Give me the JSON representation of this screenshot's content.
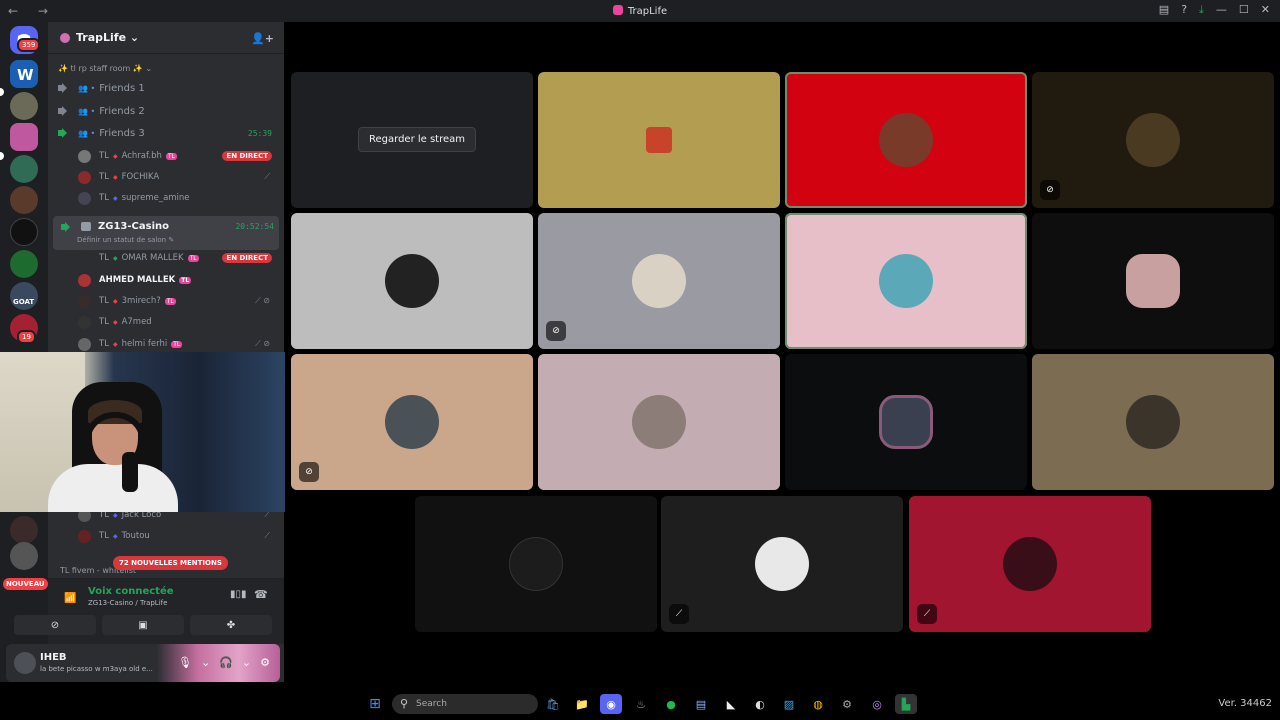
{
  "window": {
    "title": "TrapLife",
    "nav": "← →"
  },
  "guilds": {
    "dm_badge": "359",
    "server_badge": "19",
    "nouveau": "NOUVEAU"
  },
  "server": {
    "name": "TrapLife ⌄"
  },
  "category": "✨ tl rp staff room ✨ ⌄",
  "voice_channels": [
    {
      "name": "Friends 1",
      "timer": ""
    },
    {
      "name": "Friends 2",
      "timer": ""
    },
    {
      "name": "Friends 3",
      "timer": "25:39"
    }
  ],
  "friends3_users": [
    {
      "prefix": "TL",
      "name": "Achraf.bh",
      "tag": "TL",
      "live": "EN DIRECT"
    },
    {
      "prefix": "TL",
      "name": "FOCHIKA",
      "tag": "",
      "live": ""
    },
    {
      "prefix": "TL",
      "name": "supreme_amine",
      "tag": "",
      "live": ""
    }
  ],
  "casino": {
    "name": "ZG13-Casino",
    "status": "Définir un statut de salon ✎",
    "timer": "20:52:54"
  },
  "casino_users": [
    {
      "prefix": "TL",
      "name": "OMAR MALLEK",
      "tag": "TL",
      "live": "EN DIRECT"
    },
    {
      "prefix": "",
      "name": "AHMED MALLEK",
      "tag": "TL",
      "live": ""
    },
    {
      "prefix": "TL",
      "name": "3mirech?",
      "tag": "TL",
      "live": ""
    },
    {
      "prefix": "TL",
      "name": "A7med",
      "tag": "",
      "live": ""
    },
    {
      "prefix": "TL",
      "name": "helmi ferhi",
      "tag": "TL",
      "live": ""
    },
    {
      "prefix": "TL",
      "name": "Jack Loco",
      "tag": "",
      "live": ""
    },
    {
      "prefix": "TL",
      "name": "Toutou",
      "tag": "",
      "live": ""
    }
  ],
  "mentions": "72 NOUVELLES MENTIONS",
  "tl_fivem": "TL fivem - whitelist",
  "voice_panel": {
    "title": "Voix connectée",
    "subtitle": "ZG13-Casino / TrapLife"
  },
  "user_panel": {
    "name": "IHEB",
    "status": "la bete picasso w m3aya old e..."
  },
  "stage": {
    "stream_button": "Regarder le stream"
  },
  "taskbar": {
    "search_placeholder": "Search",
    "version": "Ver. 34462"
  },
  "colors": {
    "accent_green": "#23a55a",
    "live_red": "#da373c",
    "blurple": "#5865f2"
  }
}
